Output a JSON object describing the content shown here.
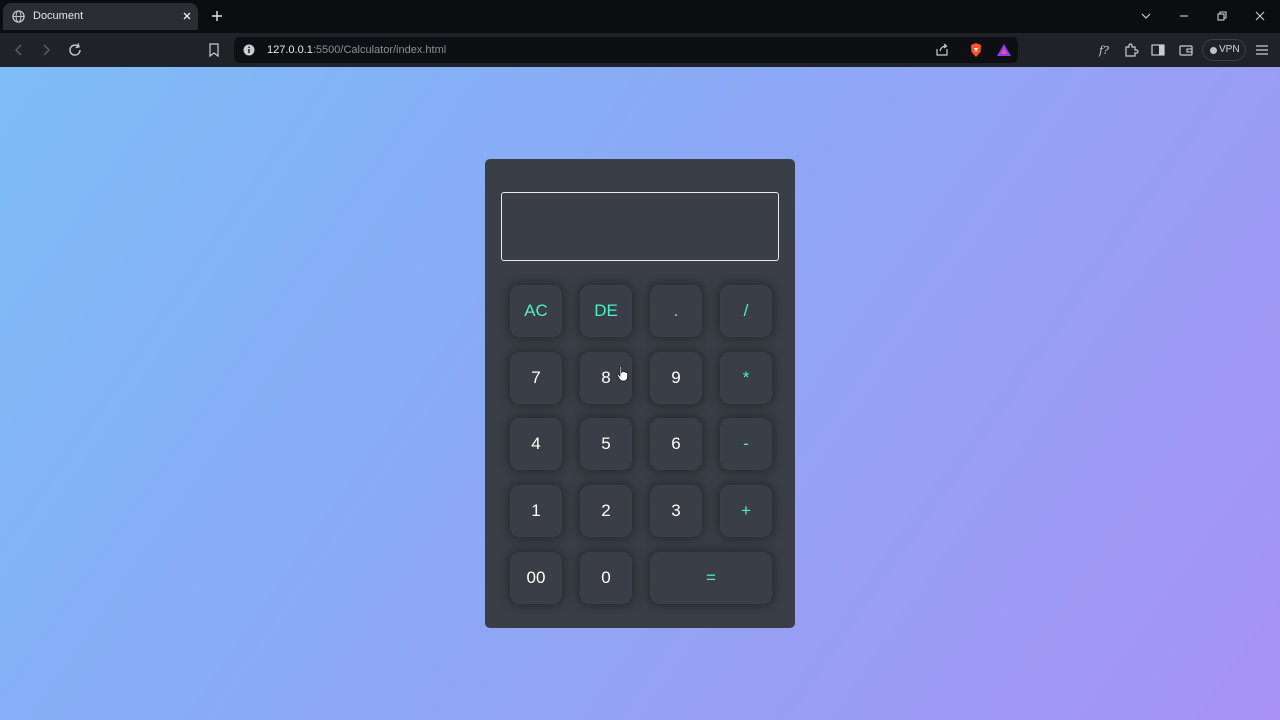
{
  "browser": {
    "tab_title": "Document",
    "url_host": "127.0.0.1",
    "url_rest": ":5500/Calculator/index.html",
    "vpn_label": "VPN"
  },
  "calculator": {
    "display_value": "",
    "rows": [
      [
        {
          "label": "AC",
          "kind": "op"
        },
        {
          "label": "DE",
          "kind": "op"
        },
        {
          "label": ".",
          "kind": "op"
        },
        {
          "label": "/",
          "kind": "op"
        }
      ],
      [
        {
          "label": "7",
          "kind": "num"
        },
        {
          "label": "8",
          "kind": "num"
        },
        {
          "label": "9",
          "kind": "num"
        },
        {
          "label": "*",
          "kind": "op"
        }
      ],
      [
        {
          "label": "4",
          "kind": "num"
        },
        {
          "label": "5",
          "kind": "num"
        },
        {
          "label": "6",
          "kind": "num"
        },
        {
          "label": "-",
          "kind": "op"
        }
      ],
      [
        {
          "label": "1",
          "kind": "num"
        },
        {
          "label": "2",
          "kind": "num"
        },
        {
          "label": "3",
          "kind": "num"
        },
        {
          "label": "+",
          "kind": "op"
        }
      ],
      [
        {
          "label": "00",
          "kind": "num"
        },
        {
          "label": "0",
          "kind": "num"
        },
        {
          "label": "=",
          "kind": "op"
        }
      ]
    ]
  },
  "colors": {
    "accent_operator": "#4cf0cc",
    "calculator_body": "#3a3e46",
    "gradient_start": "#7dbcf8",
    "gradient_end": "#a791f4"
  }
}
